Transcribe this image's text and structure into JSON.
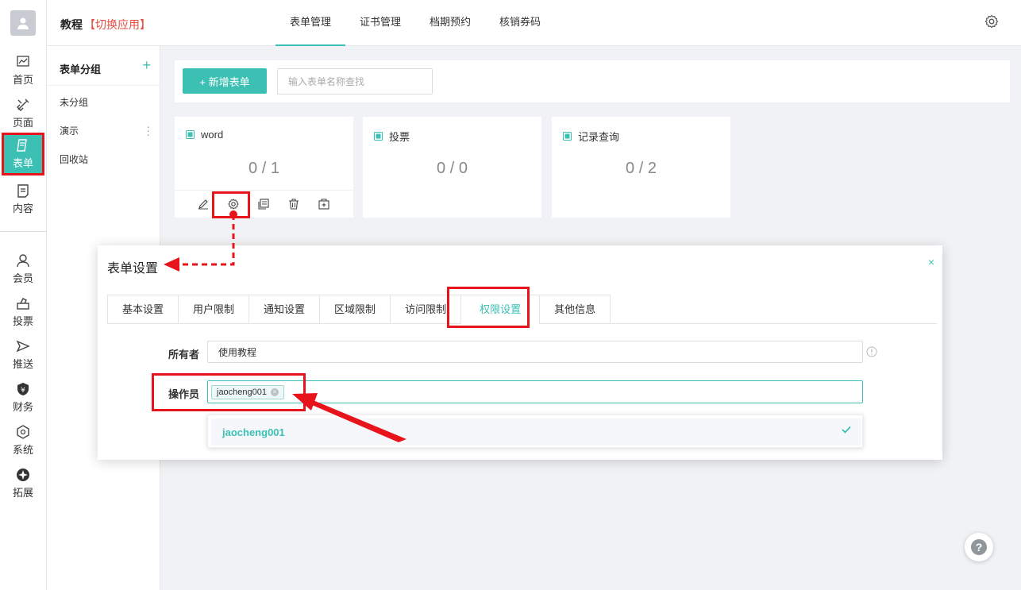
{
  "app": {
    "brand": "教程",
    "switch_app": "【切换应用】"
  },
  "rail": {
    "items": [
      {
        "label": "首页",
        "icon": "chart-icon"
      },
      {
        "label": "页面",
        "icon": "tools-icon"
      },
      {
        "label": "表单",
        "icon": "form-icon"
      },
      {
        "label": "内容",
        "icon": "document-icon"
      },
      {
        "label": "会员",
        "icon": "user-icon"
      },
      {
        "label": "投票",
        "icon": "vote-icon"
      },
      {
        "label": "推送",
        "icon": "send-icon"
      },
      {
        "label": "财务",
        "icon": "finance-icon"
      },
      {
        "label": "系统",
        "icon": "system-icon"
      },
      {
        "label": "拓展",
        "icon": "extend-icon"
      }
    ],
    "active": "表单"
  },
  "topnav": {
    "tabs": [
      "表单管理",
      "证书管理",
      "档期预约",
      "核销券码"
    ],
    "active": "表单管理"
  },
  "groups": {
    "title": "表单分组",
    "add": "+",
    "items": [
      "未分组",
      "演示",
      "回收站"
    ]
  },
  "toolbar": {
    "new_label": "+ 新增表单",
    "search_placeholder": "输入表单名称查找"
  },
  "cards": [
    {
      "title": "word",
      "count": "0 / 1"
    },
    {
      "title": "投票",
      "count": "0 / 0"
    },
    {
      "title": "记录查询",
      "count": "0 / 2"
    }
  ],
  "dialog": {
    "title": "表单设置",
    "close": "×",
    "tabs": [
      "基本设置",
      "用户限制",
      "通知设置",
      "区域限制",
      "访问限制",
      "权限设置",
      "其他信息"
    ],
    "active_tab": "权限设置",
    "owner_label": "所有者",
    "owner_value": "使用教程",
    "operator_label": "操作员",
    "operator_tags": [
      "jaocheng001"
    ],
    "dropdown_options": [
      "jaocheng001"
    ],
    "tag_remove": "×"
  },
  "help": "?",
  "colors": {
    "accent": "#3cc0b4",
    "highlight": "#e8141b",
    "danger_text": "#e54d42"
  }
}
